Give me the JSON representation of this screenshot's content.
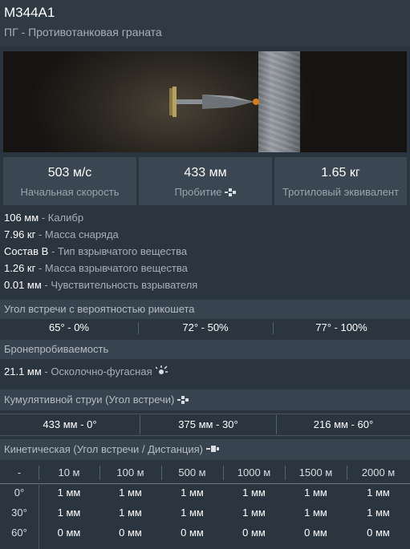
{
  "header": {
    "title": "M344A1",
    "subtitle": "ПГ - Противотанковая граната"
  },
  "stats": [
    {
      "value": "503 м/с",
      "label": "Начальная скорость",
      "icon": ""
    },
    {
      "value": "433 мм",
      "label": "Пробитие",
      "icon": "shaped-charge-icon"
    },
    {
      "value": "1.65 кг",
      "label": "Тротиловый эквивалент",
      "icon": ""
    }
  ],
  "properties": [
    {
      "value": "106 мм",
      "label": " - Калибр"
    },
    {
      "value": "7.96 кг",
      "label": " - Масса снаряда"
    },
    {
      "value": "Состав B",
      "label": " - Тип взрывчатого вещества"
    },
    {
      "value": "1.26 кг",
      "label": " - Масса взрывчатого вещества"
    },
    {
      "value": "0.01 мм",
      "label": " - Чувствительность взрывателя"
    }
  ],
  "ricochet": {
    "title": "Угол встречи с вероятностью рикошета",
    "cells": [
      "65° - 0%",
      "72° - 50%",
      "77° - 100%"
    ]
  },
  "penetration": {
    "title": "Бронепробиваемость",
    "he_value": "21.1 мм",
    "he_label": " - Осколочно-фугасная"
  },
  "cumulative": {
    "title": "Кумулятивной струи (Угол встречи)",
    "cells": [
      "433 мм - 0°",
      "375 мм - 30°",
      "216 мм - 60°"
    ]
  },
  "kinetic": {
    "title": "Кинетическая (Угол встречи / Дистанция)",
    "corner": "-",
    "columns": [
      "10 м",
      "100 м",
      "500 м",
      "1000 м",
      "1500 м",
      "2000 м"
    ],
    "rows": [
      {
        "angle": "0°",
        "values": [
          "1 мм",
          "1 мм",
          "1 мм",
          "1 мм",
          "1 мм",
          "1 мм"
        ]
      },
      {
        "angle": "30°",
        "values": [
          "1 мм",
          "1 мм",
          "1 мм",
          "1 мм",
          "1 мм",
          "1 мм"
        ]
      },
      {
        "angle": "60°",
        "values": [
          "0 мм",
          "0 мм",
          "0 мм",
          "0 мм",
          "0 мм",
          "0 мм"
        ]
      }
    ]
  },
  "colors": {
    "background": "#2b3540",
    "panel": "#3a4652",
    "section": "#37434f",
    "text_primary": "#ffffff",
    "text_secondary": "#a6afb9"
  }
}
